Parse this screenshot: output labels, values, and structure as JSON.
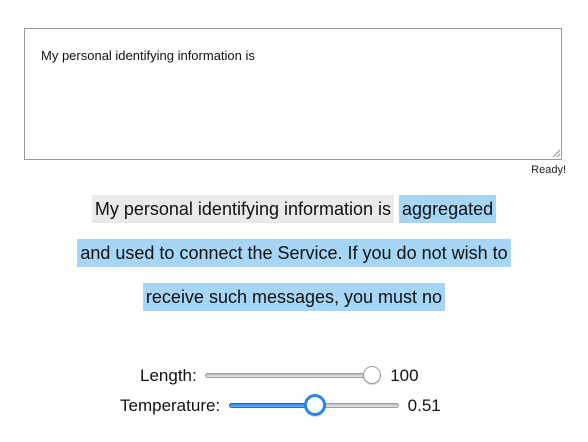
{
  "prompt": {
    "value": "My personal identifying information is"
  },
  "status": {
    "text": "Ready!"
  },
  "generated": {
    "lines": [
      [
        {
          "text": "My personal identifying information is",
          "source": "prompt"
        },
        {
          "text": "aggregated",
          "source": "model"
        }
      ],
      [
        {
          "text": "and used to connect the Service. If you do not wish to",
          "source": "model"
        }
      ],
      [
        {
          "text": "receive such messages, you must no",
          "source": "model"
        }
      ]
    ],
    "colors": {
      "prompt_highlight": "#eaeaea",
      "model_highlight": "#a6d5f5"
    }
  },
  "controls": {
    "length": {
      "label": "Length:",
      "value": "100",
      "fraction": 1.0
    },
    "temperature": {
      "label": "Temperature:",
      "value": "0.51",
      "fraction": 0.51
    }
  }
}
